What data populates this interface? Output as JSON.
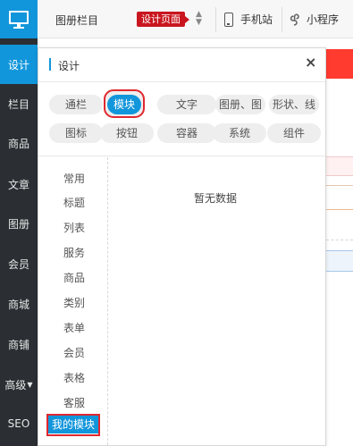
{
  "sidebar": {
    "logo_icon": "monitor-icon",
    "items": [
      {
        "label": "设计"
      },
      {
        "label": "栏目"
      },
      {
        "label": "商品"
      },
      {
        "label": "文章"
      },
      {
        "label": "图册"
      },
      {
        "label": "会员"
      },
      {
        "label": "商城"
      },
      {
        "label": "商铺"
      },
      {
        "label": "高级"
      },
      {
        "label": "SEO"
      }
    ]
  },
  "topbar": {
    "section": "图册栏目",
    "page_badge": "设计页面",
    "mobile_label": "手机站",
    "miniapp_label": "小程序"
  },
  "panel": {
    "title": "设计",
    "close": "×",
    "categories": [
      {
        "label": "通栏"
      },
      {
        "label": "模块"
      },
      {
        "label": "文字"
      },
      {
        "label": "图册、图"
      },
      {
        "label": "形状、线"
      },
      {
        "label": "图标"
      },
      {
        "label": "按钮"
      },
      {
        "label": "容器"
      },
      {
        "label": "系统"
      },
      {
        "label": "组件"
      }
    ],
    "subnav": [
      {
        "label": "常用"
      },
      {
        "label": "标题"
      },
      {
        "label": "列表"
      },
      {
        "label": "服务"
      },
      {
        "label": "商品"
      },
      {
        "label": "类别"
      },
      {
        "label": "表单"
      },
      {
        "label": "会员"
      },
      {
        "label": "表格"
      },
      {
        "label": "客服"
      },
      {
        "label": "我的模块"
      }
    ],
    "empty_text": "暂无数据"
  },
  "colors": {
    "accent": "#1296db",
    "sidebar_bg": "#2b2f33",
    "badge_red": "#c9151e",
    "highlight_frame": "#e0282f"
  }
}
